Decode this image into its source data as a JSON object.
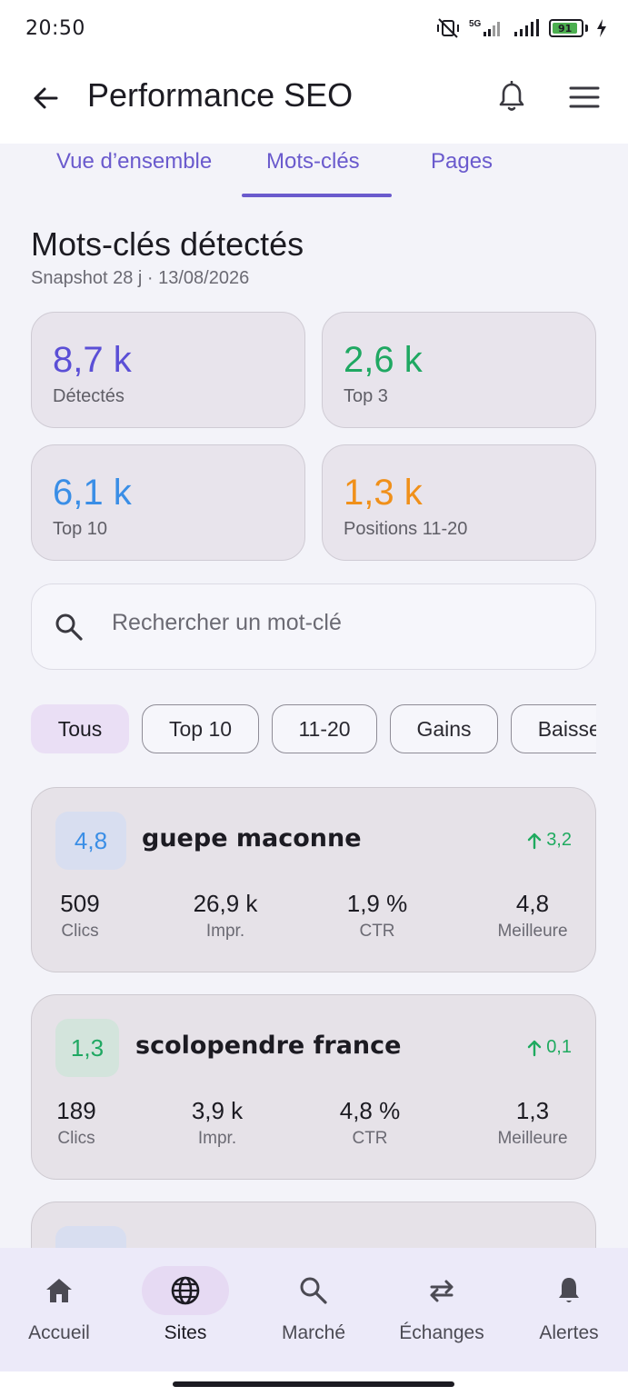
{
  "status_bar": {
    "time": "20:50",
    "battery_level": "91",
    "network": "5G"
  },
  "app_bar": {
    "title": "Performance SEO"
  },
  "tabs": [
    {
      "label": "Vue d’ensemble",
      "active": false
    },
    {
      "label": "Mots-clés",
      "active": true
    },
    {
      "label": "Pages",
      "active": false
    }
  ],
  "section": {
    "title": "Mots-clés détectés",
    "subtitle": "Snapshot 28 j · 13/08/2026"
  },
  "stats": [
    {
      "value": "8,7 k",
      "label": "Détectés",
      "color": "#5b4fd6"
    },
    {
      "value": "2,6 k",
      "label": "Top 3",
      "color": "#1fa862"
    },
    {
      "value": "6,1 k",
      "label": "Top 10",
      "color": "#3a8ee6"
    },
    {
      "value": "1,3 k",
      "label": "Positions 11-20",
      "color": "#f0901a"
    }
  ],
  "search": {
    "placeholder": "Rechercher un mot-clé"
  },
  "filters": [
    {
      "label": "Tous",
      "active": true
    },
    {
      "label": "Top 10",
      "active": false
    },
    {
      "label": "11-20",
      "active": false
    },
    {
      "label": "Gains",
      "active": false
    },
    {
      "label": "Baisses",
      "active": false
    }
  ],
  "keywords": [
    {
      "position": "4,8",
      "position_color": "#3a8ee6",
      "position_bg": "#d8def0",
      "name": "guepe maconne",
      "trend": "3,2",
      "metrics": [
        {
          "value": "509",
          "label": "Clics"
        },
        {
          "value": "26,9 k",
          "label": "Impr."
        },
        {
          "value": "1,9 %",
          "label": "CTR"
        },
        {
          "value": "4,8",
          "label": "Meilleure"
        }
      ]
    },
    {
      "position": "1,3",
      "position_color": "#1fa862",
      "position_bg": "#d3e4dc",
      "name": "scolopendre france",
      "trend": "0,1",
      "metrics": [
        {
          "value": "189",
          "label": "Clics"
        },
        {
          "value": "3,9 k",
          "label": "Impr."
        },
        {
          "value": "4,8 %",
          "label": "CTR"
        },
        {
          "value": "1,3",
          "label": "Meilleure"
        }
      ]
    }
  ],
  "bottom_nav": [
    {
      "label": "Accueil",
      "icon": "home-icon",
      "active": false
    },
    {
      "label": "Sites",
      "icon": "globe-icon",
      "active": true
    },
    {
      "label": "Marché",
      "icon": "search-icon",
      "active": false
    },
    {
      "label": "Échanges",
      "icon": "swap-icon",
      "active": false
    },
    {
      "label": "Alertes",
      "icon": "bell-icon",
      "active": false
    }
  ]
}
